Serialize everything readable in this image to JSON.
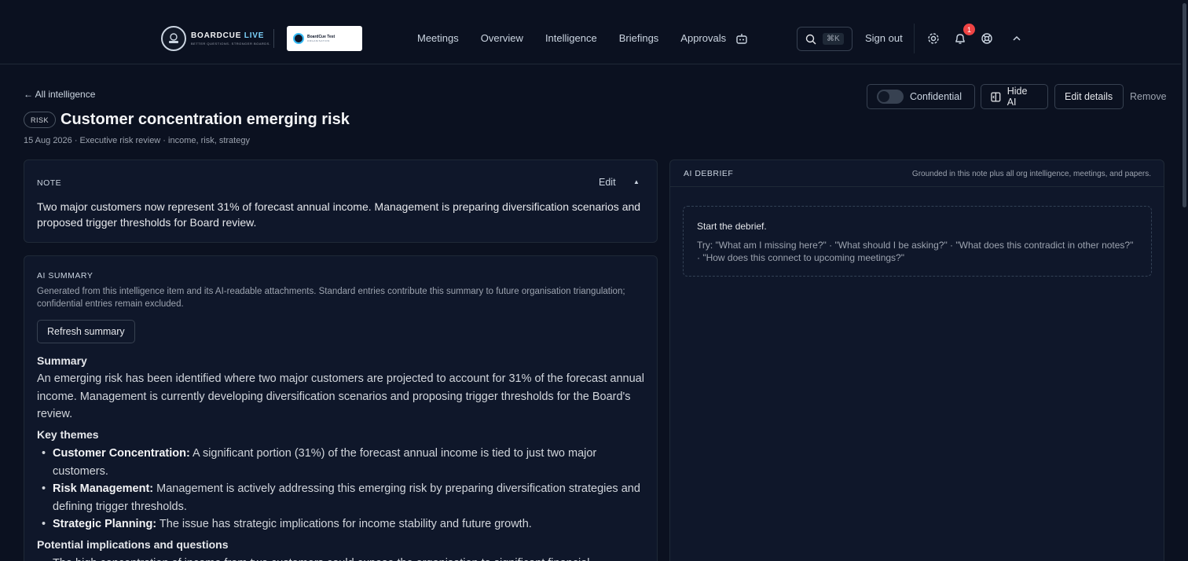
{
  "brand": {
    "name": "BOARDCUE",
    "name_suffix": "LIVE",
    "tagline": "BETTER QUESTIONS. STRONGER BOARDS."
  },
  "org": {
    "name": "BoardCue Test",
    "subtitle": "ORGANISATION"
  },
  "nav": {
    "links": [
      "Meetings",
      "Overview",
      "Intelligence",
      "Briefings",
      "Approvals"
    ],
    "search_shortcut": "⌘K",
    "sign_out": "Sign out",
    "notification_count": "1"
  },
  "page": {
    "back_label": "← All intelligence",
    "tag": "RISK",
    "title": "Customer concentration emerging risk",
    "meta": "15 Aug 2026 · Executive risk review · income, risk, strategy"
  },
  "toolbar": {
    "confidential_label": "Confidential",
    "confidential_on": false,
    "hide_ai_label": "Hide AI",
    "edit_details_label": "Edit details",
    "remove_label": "Remove"
  },
  "note": {
    "label": "NOTE",
    "edit_label": "Edit",
    "caret": "▲",
    "text": "Two major customers now represent 31% of forecast annual income. Management is preparing diversification scenarios and proposed trigger thresholds for Board review."
  },
  "ai_summary": {
    "label": "AI SUMMARY",
    "description": "Generated from this intelligence item and its AI-readable attachments. Standard entries contribute this summary to future organisation triangulation; confidential entries remain excluded.",
    "refresh_label": "Refresh summary",
    "summary_heading": "Summary",
    "summary_text": "An emerging risk has been identified where two major customers are projected to account for 31% of the forecast annual income. Management is currently developing diversification scenarios and proposing trigger thresholds for the Board's review.",
    "themes_heading": "Key themes",
    "themes": [
      {
        "title": "Customer Concentration:",
        "text": " A significant portion (31%) of the forecast annual income is tied to just two major customers."
      },
      {
        "title": "Risk Management:",
        "text": " Management is actively addressing this emerging risk by preparing diversification strategies and defining trigger thresholds."
      },
      {
        "title": "Strategic Planning:",
        "text": " The issue has strategic implications for income stability and future growth."
      }
    ],
    "implications_heading": "Potential implications and questions",
    "implications_first": "The high concentration of income from two customers could expose the organisation to significant financial"
  },
  "debrief": {
    "label": "AI DEBRIEF",
    "grounding": "Grounded in this note plus all org intelligence, meetings, and papers.",
    "start_title": "Start the debrief.",
    "try_text": "Try: \"What am I missing here?\" · \"What should I be asking?\" · \"What does this contradict in other notes?\" · \"How does this connect to upcoming meetings?\""
  },
  "colors": {
    "background": "#0b1120",
    "card": "#0f172a",
    "border": "#1f2937",
    "accent": "#7dd3fc",
    "badge": "#ef4444"
  }
}
